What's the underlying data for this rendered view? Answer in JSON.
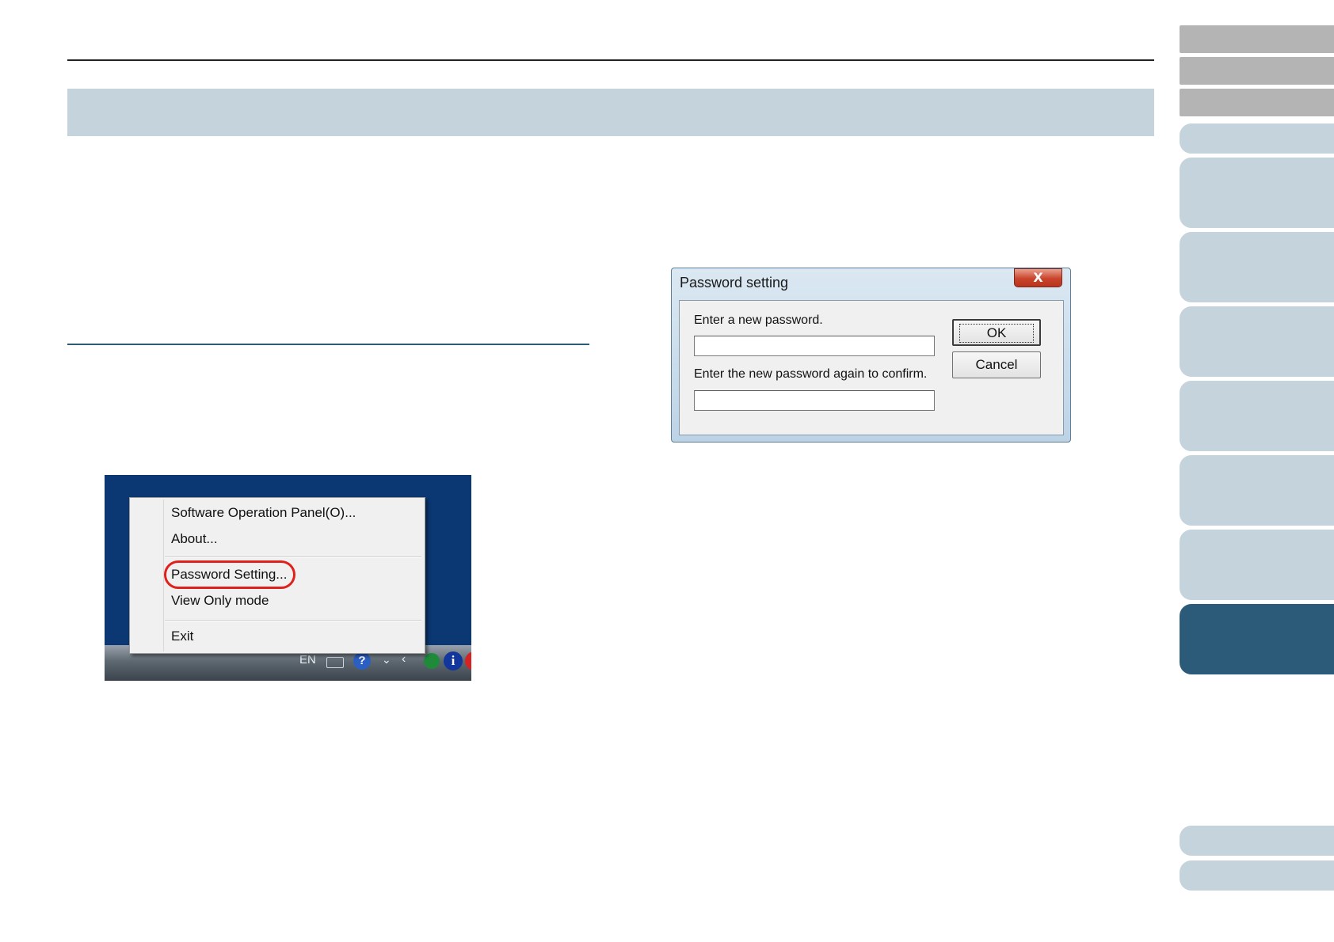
{
  "context_menu": {
    "items": [
      {
        "label": "Software Operation Panel(O)..."
      },
      {
        "label": "About..."
      },
      {
        "label": "Password Setting..."
      },
      {
        "label": "View Only mode"
      },
      {
        "label": "Exit"
      }
    ],
    "highlighted_item": "Password Setting...",
    "highlight_color": "#e0201a"
  },
  "taskbar": {
    "language": "EN",
    "icons": [
      "keyboard-icon",
      "help-icon",
      "show-hidden-icons-arrow",
      "back-arrow-icon",
      "scanner-tray-icon",
      "info-icon",
      "red-status-icon"
    ]
  },
  "password_dialog": {
    "title": "Password setting",
    "close_glyph": "X",
    "new_password_label": "Enter a new password.",
    "confirm_password_label": "Enter the new password again to confirm.",
    "new_password_value": "",
    "confirm_password_value": "",
    "ok_label": "OK",
    "cancel_label": "Cancel"
  },
  "colors": {
    "header_band": "#c4d3dc",
    "section_rule": "#2e5a74",
    "nav_grey": "#b4b4b4",
    "nav_light": "#c4d3dc",
    "nav_active": "#2b5b78",
    "desktop_blue": "#0b3873"
  }
}
